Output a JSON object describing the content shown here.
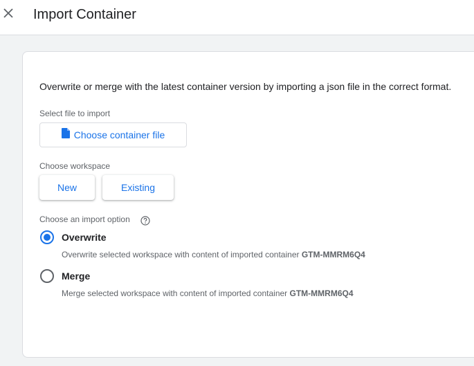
{
  "header": {
    "title": "Import Container",
    "close_icon": "close-icon"
  },
  "intro": "Overwrite or merge with the latest container version by importing a json file in the correct format.",
  "file_section": {
    "label": "Select file to import",
    "button_label": "Choose container file",
    "icon": "file-icon"
  },
  "workspace_section": {
    "label": "Choose workspace",
    "options": [
      "New",
      "Existing"
    ]
  },
  "import_section": {
    "label": "Choose an import option",
    "help_icon": "help-icon",
    "options": [
      {
        "title": "Overwrite",
        "description": "Overwrite selected workspace with content of imported container",
        "container_id": "GTM-MMRM6Q4",
        "selected": true
      },
      {
        "title": "Merge",
        "description": "Merge selected workspace with content of imported container",
        "container_id": "GTM-MMRM6Q4",
        "selected": false
      }
    ]
  },
  "colors": {
    "accent": "#1a73e8",
    "text": "#202124",
    "muted": "#5f6368",
    "border": "#dadce0",
    "background": "#f1f3f4"
  }
}
